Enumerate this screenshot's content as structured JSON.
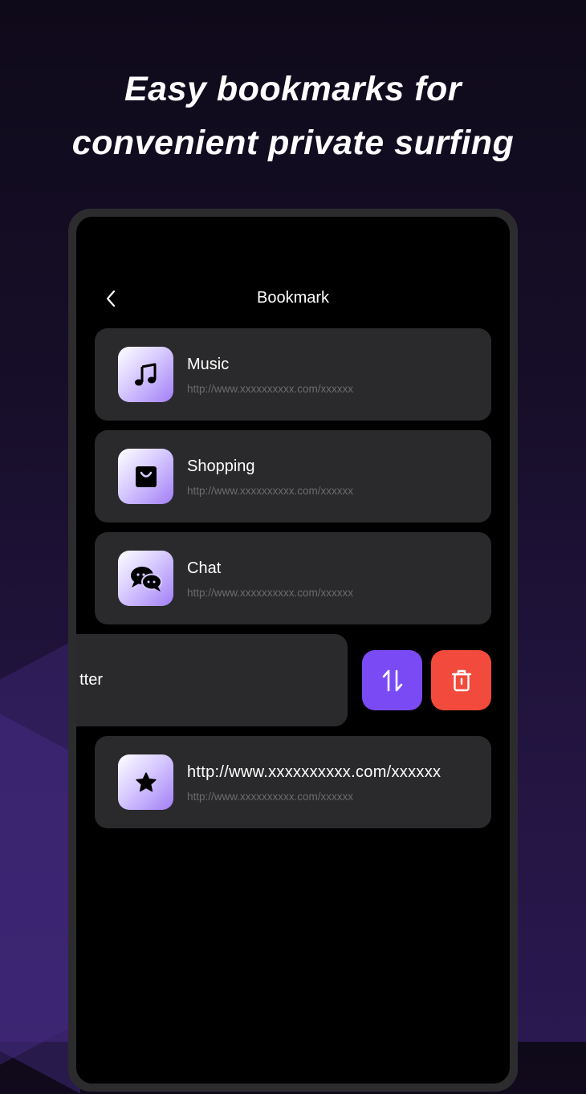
{
  "headline": {
    "line1": "Easy bookmarks for",
    "line2": "convenient private surfing"
  },
  "screen": {
    "title": "Bookmark",
    "back_icon": "chevron-left-icon"
  },
  "bookmarks": [
    {
      "title": "Music",
      "url": "http://www.xxxxxxxxxx.com/xxxxxx",
      "icon": "music-note-icon"
    },
    {
      "title": "Shopping",
      "url": "http://www.xxxxxxxxxx.com/xxxxxx",
      "icon": "shopping-bag-icon"
    },
    {
      "title": "Chat",
      "url": "http://www.xxxxxxxxxx.com/xxxxxx",
      "icon": "chat-bubbles-icon"
    },
    {
      "title": "http://www.xxxxxxxxxx.com/xxxxxx",
      "url": "http://www.xxxxxxxxxx.com/xxxxxx",
      "icon": "star-icon"
    }
  ],
  "swiped_item": {
    "visible_title": "tter",
    "actions": [
      {
        "name": "reorder",
        "icon": "sort-arrows-icon",
        "color": "#7a4af5"
      },
      {
        "name": "delete",
        "icon": "trash-icon",
        "color": "#f24a3c"
      }
    ]
  },
  "colors": {
    "accent": "#7a4af5",
    "danger": "#f24a3c",
    "card_bg": "#2a2a2c",
    "url_text": "#6b6b70"
  }
}
